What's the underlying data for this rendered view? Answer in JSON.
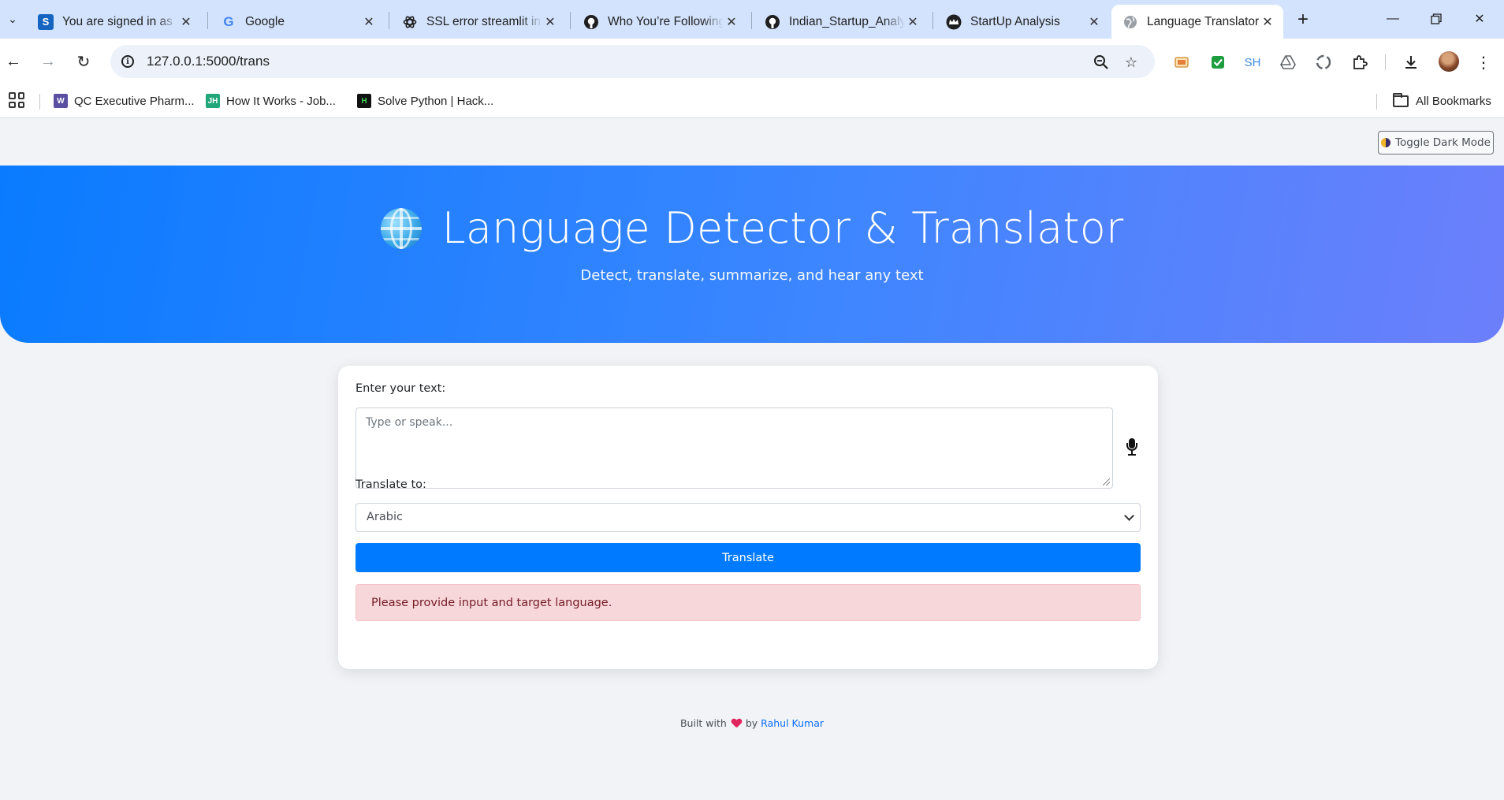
{
  "browser": {
    "tabs": [
      {
        "title": "You are signed in as",
        "favicon": "S",
        "favicon_color": "#1565c0"
      },
      {
        "title": "Google",
        "favicon": "G",
        "favicon_color": "#4285f4"
      },
      {
        "title": "SSL error streamlit in",
        "favicon": "openai-icon",
        "favicon_color": "#1f1f1f"
      },
      {
        "title": "Who You’re Following",
        "favicon": "github-icon",
        "favicon_color": "#1f1f1f"
      },
      {
        "title": "Indian_Startup_Analy",
        "favicon": "github-icon",
        "favicon_color": "#1f1f1f"
      },
      {
        "title": "StartUp Analysis",
        "favicon": "streamlit-icon",
        "favicon_color": "#1f1f1f"
      },
      {
        "title": "Language Translator",
        "favicon": "globe-icon",
        "favicon_color": "#5f6368",
        "active": true
      }
    ],
    "url": "127.0.0.1:5000/trans",
    "extensions": [
      "screen-capture-icon",
      "green-check-icon",
      "SH",
      "drive-icon",
      "recycle-icon",
      "puzzle-icon"
    ],
    "bookmarks": [
      {
        "label": "QC Executive Pharm...",
        "icon": "W",
        "color": "#5a4fa0"
      },
      {
        "label": "How It Works - Job...",
        "icon": "JH",
        "color": "#21a67a"
      },
      {
        "label": "Solve Python | Hack...",
        "icon": "H",
        "color": "#111111"
      }
    ],
    "all_bookmarks_label": "All Bookmarks"
  },
  "page": {
    "toggle_dark_mode": "Toggle Dark Mode",
    "hero": {
      "title": "Language Detector & Translator",
      "subtitle": "Detect, translate, summarize, and hear any text"
    },
    "form": {
      "input_label": "Enter your text:",
      "input_placeholder": "Type or speak...",
      "target_label": "Translate to:",
      "target_selected": "Arabic",
      "submit_label": "Translate",
      "alert_message": "Please provide input and target language."
    },
    "footer": {
      "prefix": "Built with",
      "by": "by",
      "author": "Rahul Kumar"
    }
  },
  "colors": {
    "primary": "#007bff",
    "hero_gradient_start": "#0a7bff",
    "hero_gradient_end": "#6c7ffb",
    "alert_bg": "#f8d7da",
    "alert_text": "#721c24"
  }
}
